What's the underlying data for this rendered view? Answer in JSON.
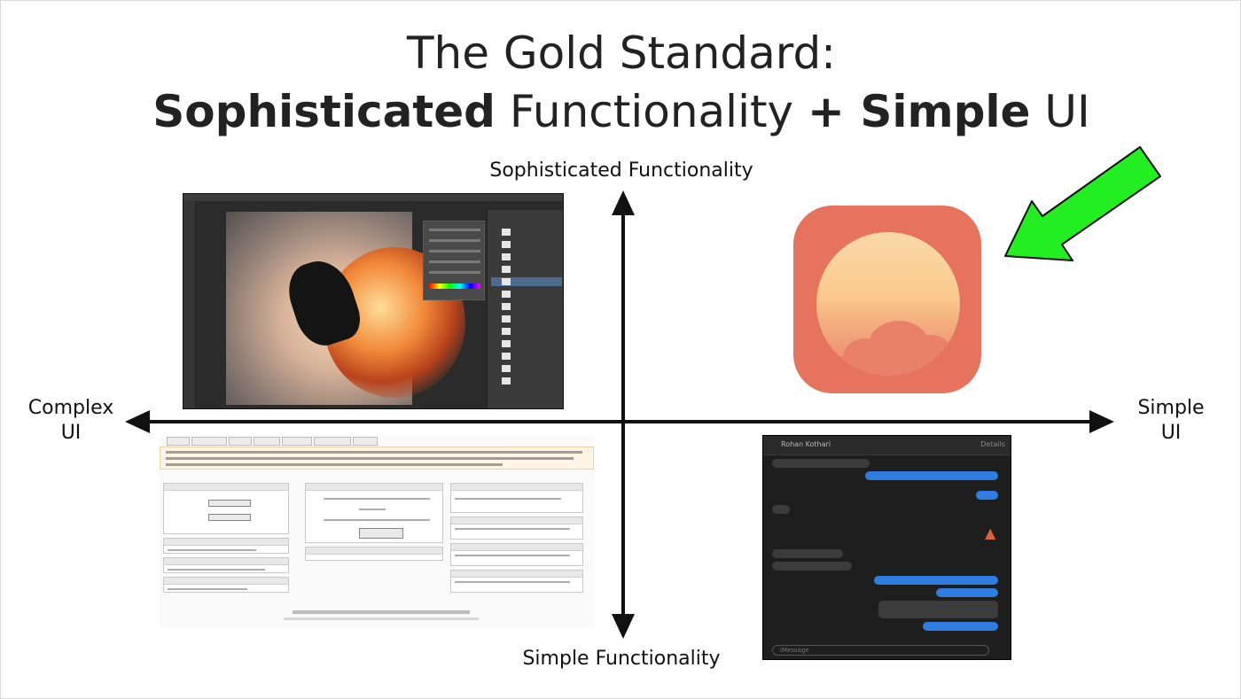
{
  "title": {
    "line1": "The Gold Standard:",
    "line2": {
      "bold1": "Sophisticated",
      "mid": " Functionality ",
      "bold2": "+ Simple",
      "end": " UI"
    }
  },
  "axes": {
    "top": "Sophisticated Functionality",
    "bottom": "Simple Functionality",
    "left_line1": "Complex",
    "left_line2": "UI",
    "right_line1": "Simple",
    "right_line2": "UI"
  },
  "chat": {
    "contact_name": "Rohan Kothari",
    "details_label": "Details",
    "compose_placeholder": "iMessage"
  },
  "colors": {
    "icon_background": "#e6735e",
    "arrow": "#22ee22",
    "axis": "#111111"
  },
  "icons": {
    "arrow": "green-pointer-arrow-icon",
    "app": "sunrise-app-icon",
    "rocket": "rocket-icon"
  }
}
